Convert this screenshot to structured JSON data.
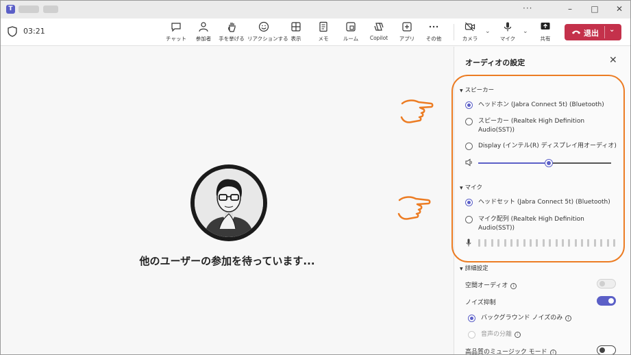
{
  "toolbar": {
    "timer": "03:21",
    "tools": [
      {
        "label": "チャット",
        "icon": "chat-icon"
      },
      {
        "label": "参加者",
        "icon": "people-icon"
      },
      {
        "label": "手を挙げる",
        "icon": "raise-hand-icon"
      },
      {
        "label": "リアクションする",
        "icon": "smile-icon"
      },
      {
        "label": "表示",
        "icon": "grid-icon"
      },
      {
        "label": "メモ",
        "icon": "notes-icon"
      },
      {
        "label": "ルーム",
        "icon": "rooms-icon"
      },
      {
        "label": "Copilot",
        "icon": "copilot-icon"
      },
      {
        "label": "アプリ",
        "icon": "apps-icon"
      },
      {
        "label": "その他",
        "icon": "more-icon"
      }
    ],
    "camera_label": "カメラ",
    "mic_label": "マイク",
    "share_label": "共有",
    "leave_label": "退出"
  },
  "stage": {
    "waiting_text": "他のユーザーの参加を待っています..."
  },
  "panel": {
    "title": "オーディオの設定",
    "speaker_section": "スピーカー",
    "speakers": [
      {
        "label": "ヘッドホン (Jabra Connect 5t) (Bluetooth)",
        "selected": true
      },
      {
        "label": "スピーカー (Realtek High Definition Audio(SST))",
        "selected": false
      },
      {
        "label": "Display (インテル(R) ディスプレイ用オーディオ)",
        "selected": false
      }
    ],
    "speaker_volume_fraction": 0.53,
    "mic_section": "マイク",
    "mics": [
      {
        "label": "ヘッドセット (Jabra Connect 5t) (Bluetooth)",
        "selected": true
      },
      {
        "label": "マイク配列 (Realtek High Definition Audio(SST))",
        "selected": false
      }
    ],
    "advanced_section": "詳細設定",
    "spatial_audio_label": "空間オーディオ",
    "noise_suppression_label": "ノイズ抑制",
    "background_noise_only_label": "バックグラウンド ノイズのみ",
    "voice_isolation_label": "音声の分離",
    "hifi_music_label": "高品質のミュージック モード"
  },
  "colors": {
    "accent": "#5b5fc7",
    "leave": "#c4314b",
    "annotation": "#ec7c23"
  }
}
